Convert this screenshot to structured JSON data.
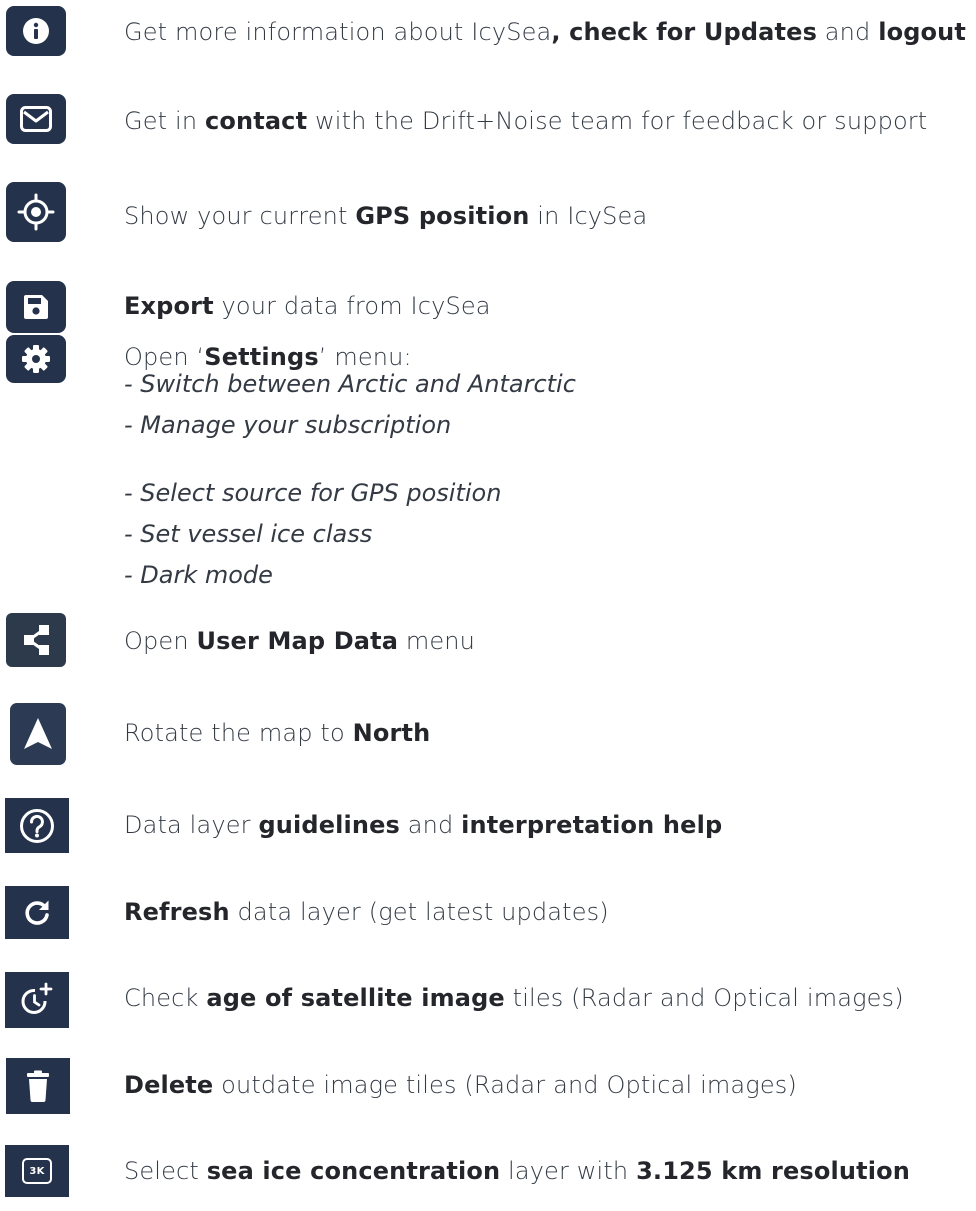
{
  "items": [
    {
      "icon": "info-icon",
      "parts": [
        {
          "t": "Get more information about IcySea",
          "b": false
        },
        {
          "t": ", check for Updates",
          "b": true
        },
        {
          "t": " and ",
          "b": false
        },
        {
          "t": "logout",
          "b": true
        }
      ]
    },
    {
      "icon": "mail-icon",
      "parts": [
        {
          "t": "Get in ",
          "b": false
        },
        {
          "t": "contact",
          "b": true
        },
        {
          "t": " with the Drift+Noise team for feedback or support",
          "b": false
        }
      ]
    },
    {
      "icon": "gps-target-icon",
      "parts": [
        {
          "t": "Show your current ",
          "b": false
        },
        {
          "t": "GPS position",
          "b": true
        },
        {
          "t": " in IcySea",
          "b": false
        }
      ]
    },
    {
      "icon": "save-icon",
      "parts": [
        {
          "t": "Export",
          "b": true
        },
        {
          "t": " your data from IcySea",
          "b": false
        }
      ]
    },
    {
      "icon": "gear-icon",
      "parts": [
        {
          "t": "Open ‘",
          "b": false
        },
        {
          "t": "Settings",
          "b": true
        },
        {
          "t": "’ menu:",
          "b": false
        }
      ],
      "subitems": [
        "- Switch between Arctic and Antarctic",
        "- Manage your subscription",
        "- Select source for GPS position",
        "- Set vessel ice class",
        "- Dark mode"
      ]
    },
    {
      "icon": "share-nodes-icon",
      "parts": [
        {
          "t": "Open ",
          "b": false
        },
        {
          "t": "User Map Data",
          "b": true
        },
        {
          "t": " menu",
          "b": false
        }
      ]
    },
    {
      "icon": "north-arrow-icon",
      "parts": [
        {
          "t": "Rotate the map to ",
          "b": false
        },
        {
          "t": "North",
          "b": true
        }
      ]
    },
    {
      "icon": "help-circle-icon",
      "parts": [
        {
          "t": "Data layer ",
          "b": false
        },
        {
          "t": "guidelines",
          "b": true
        },
        {
          "t": " and ",
          "b": false
        },
        {
          "t": "interpretation help",
          "b": true
        }
      ]
    },
    {
      "icon": "refresh-icon",
      "parts": [
        {
          "t": "Refresh",
          "b": true
        },
        {
          "t": " data layer (get latest updates)",
          "b": false
        }
      ]
    },
    {
      "icon": "clock-plus-icon",
      "parts": [
        {
          "t": "Check ",
          "b": false
        },
        {
          "t": "age of satellite image",
          "b": true
        },
        {
          "t": " tiles (Radar and Optical images)",
          "b": false
        }
      ]
    },
    {
      "icon": "trash-icon",
      "parts": [
        {
          "t": "Delete",
          "b": true
        },
        {
          "t": " outdate image tiles (Radar and Optical images)",
          "b": false
        }
      ]
    },
    {
      "icon": "3k-layer-icon",
      "label": "3K",
      "parts": [
        {
          "t": "Select ",
          "b": false
        },
        {
          "t": "sea ice concentration",
          "b": true
        },
        {
          "t": " layer with ",
          "b": false
        },
        {
          "t": "3.125 km resolution",
          "b": true
        }
      ]
    }
  ],
  "colors": {
    "button": "#25324b",
    "icon": "#ffffff",
    "text": "#333a44"
  }
}
